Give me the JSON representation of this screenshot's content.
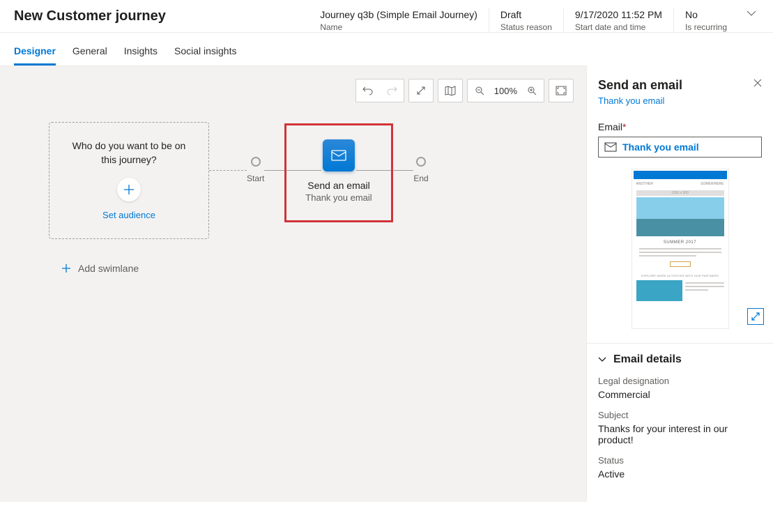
{
  "header": {
    "page_title": "New Customer journey",
    "meta": [
      {
        "value": "Journey q3b (Simple Email Journey)",
        "label": "Name"
      },
      {
        "value": "Draft",
        "label": "Status reason"
      },
      {
        "value": "9/17/2020 11:52 PM",
        "label": "Start date and time"
      },
      {
        "value": "No",
        "label": "Is recurring"
      }
    ]
  },
  "tabs": [
    "Designer",
    "General",
    "Insights",
    "Social insights"
  ],
  "canvas": {
    "toolbar_zoom": "100%",
    "audience_prompt": "Who do you want to be on this journey?",
    "set_audience": "Set audience",
    "add_swimlane": "Add swimlane",
    "start_label": "Start",
    "end_label": "End",
    "email_tile_title": "Send an email",
    "email_tile_sub": "Thank you email"
  },
  "panel": {
    "title": "Send an email",
    "link": "Thank you email",
    "email_label": "Email",
    "email_value": "Thank you email",
    "preview": {
      "header_left": "ANOTHER",
      "header_right": "SOMEWHERE",
      "placeholder": "1350 x 300",
      "summer": "SUMMER 2017",
      "subhead": "EXPLORE MORE ACTIVITIES WITH OUR PARTNERS"
    },
    "section_title": "Email details",
    "details": [
      {
        "label": "Legal designation",
        "value": "Commercial"
      },
      {
        "label": "Subject",
        "value": "Thanks for your interest in our product!"
      },
      {
        "label": "Status",
        "value": "Active"
      }
    ]
  }
}
